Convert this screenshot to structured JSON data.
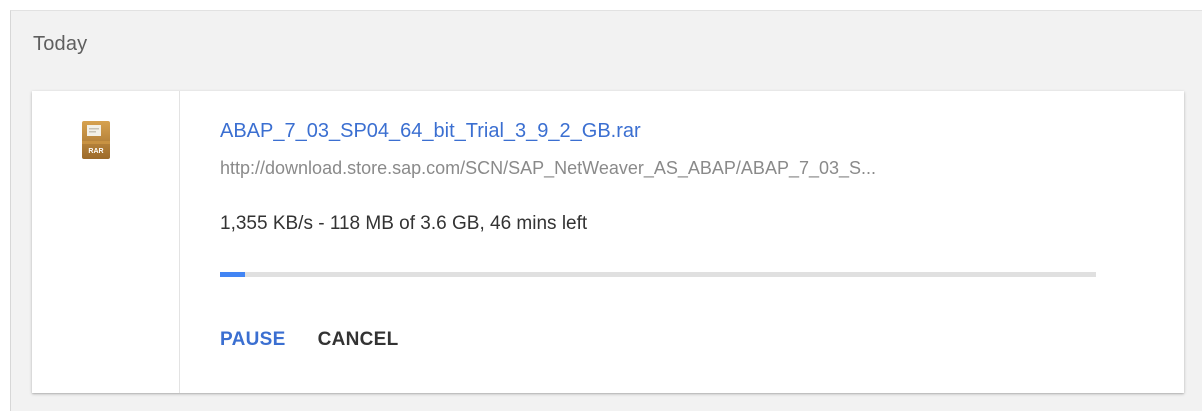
{
  "section": {
    "title": "Today"
  },
  "download": {
    "file_type_icon": "rar-archive-icon",
    "file_type_label": "RAR",
    "file_name": "ABAP_7_03_SP04_64_bit_Trial_3_9_2_GB.rar",
    "url": "http://download.store.sap.com/SCN/SAP_NetWeaver_AS_ABAP/ABAP_7_03_S...",
    "status": "1,355 KB/s - 118 MB of 3.6 GB, 46 mins left",
    "progress_fraction": 0.028,
    "actions": {
      "pause_label": "PAUSE",
      "cancel_label": "CANCEL"
    }
  },
  "colors": {
    "link": "#3b6fd1",
    "progress": "#4285f4",
    "panel_bg": "#f2f2f2"
  }
}
